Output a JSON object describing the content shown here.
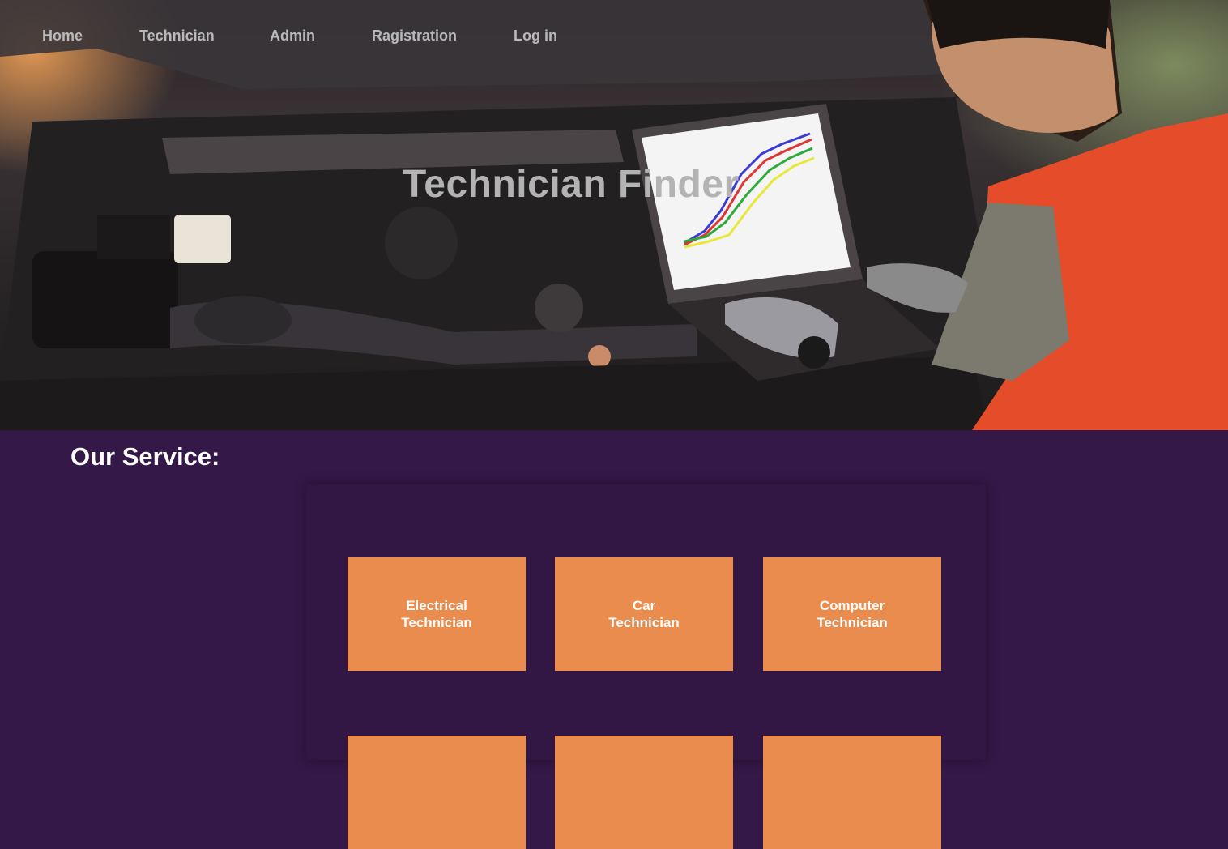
{
  "nav": {
    "items": [
      {
        "label": "Home"
      },
      {
        "label": "Technician"
      },
      {
        "label": "Admin"
      },
      {
        "label": "Ragistration"
      },
      {
        "label": "Log in"
      }
    ]
  },
  "hero": {
    "title": "Technician Finder",
    "image_description_icon": "mechanic-laptop-engine-photo"
  },
  "services": {
    "heading": "Our Service:",
    "cards": [
      {
        "label": "Electrical Technician"
      },
      {
        "label": "Car Technician"
      },
      {
        "label": "Computer Technician"
      },
      {
        "label": ""
      },
      {
        "label": ""
      },
      {
        "label": ""
      }
    ]
  },
  "colors": {
    "page_background": "#341847",
    "card_background": "#ea8c4e",
    "card_text": "#ffffff",
    "nav_text": "#b9b9b9"
  }
}
